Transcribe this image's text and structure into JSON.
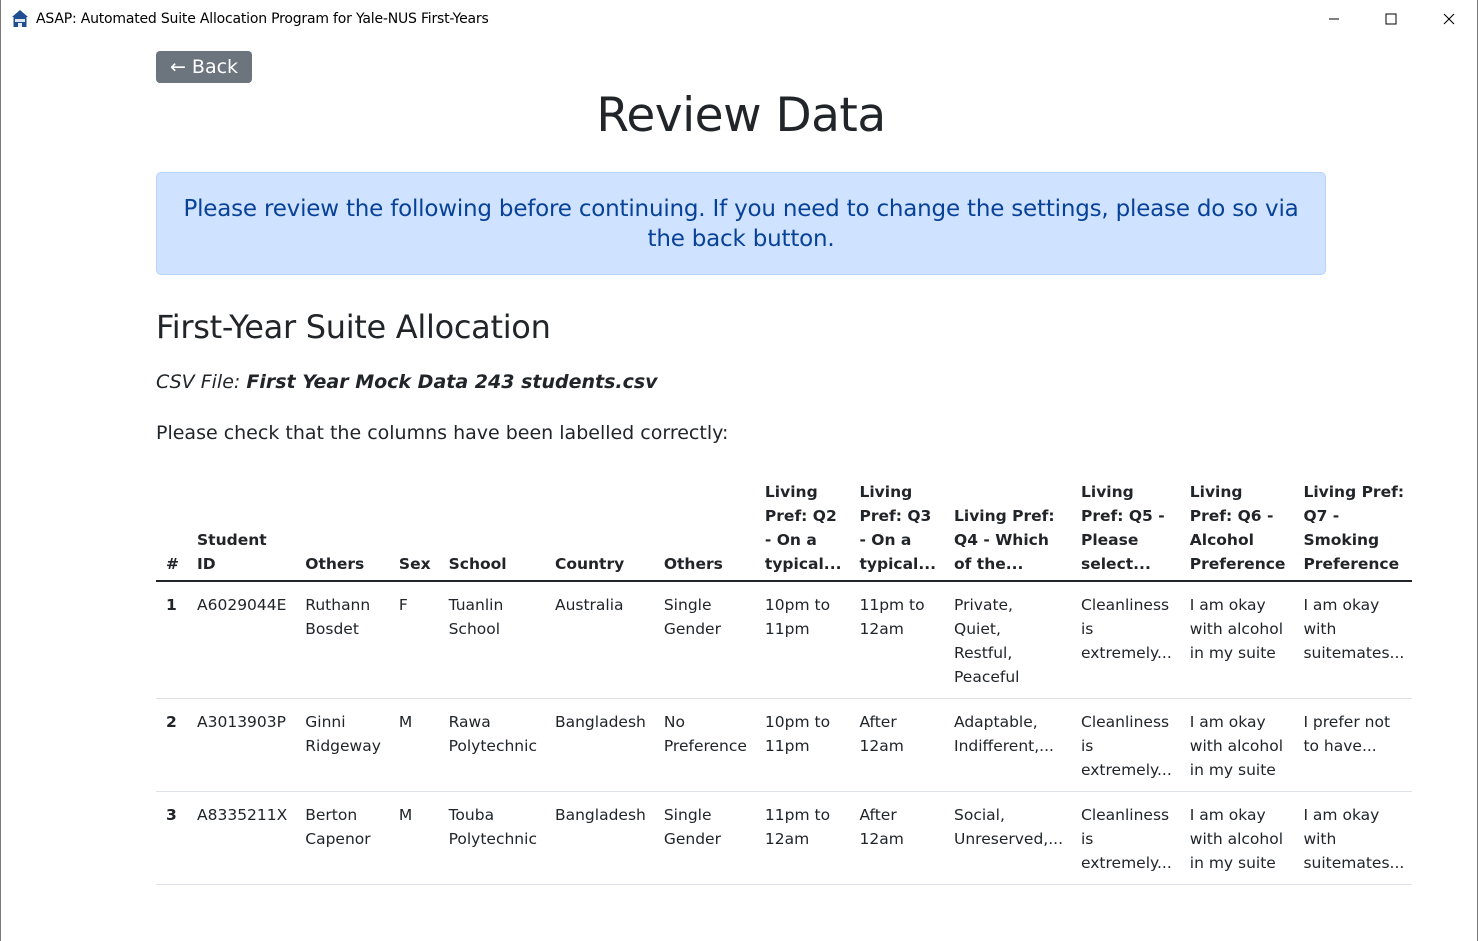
{
  "window": {
    "title": "ASAP: Automated Suite Allocation Program for Yale-NUS First-Years",
    "app_icon": "house-icon",
    "controls": {
      "minimize_icon": "minimize-icon",
      "maximize_icon": "maximize-icon",
      "close_icon": "close-icon"
    }
  },
  "page": {
    "back_label": "← Back",
    "title": "Review Data",
    "alert_text": "Please review the following before continuing. If you need to change the settings, please do so via the back button.",
    "section_title": "First-Year Suite Allocation",
    "csv_label": "CSV File: ",
    "csv_filename": "First Year Mock Data 243 students.csv",
    "check_text": "Please check that the columns have been labelled correctly:"
  },
  "colors": {
    "back_button_bg": "#6c757d",
    "alert_bg": "#cfe2ff",
    "alert_border": "#b6d4fe",
    "alert_text": "#084298"
  },
  "table": {
    "headers": [
      "#",
      "Student ID",
      "Others",
      "Sex",
      "School",
      "Country",
      "Others",
      "Living Pref: Q2 - On a typical...",
      "Living Pref: Q3 - On a typical...",
      "Living Pref: Q4 - Which of the...",
      "Living Pref: Q5 - Please select...",
      "Living Pref: Q6 - Alcohol Preference",
      "Living Pref: Q7 - Smoking Preference"
    ],
    "rows": [
      [
        "1",
        "A6029044E",
        "Ruthann Bosdet",
        "F",
        "Tuanlin School",
        "Australia",
        "Single Gender",
        "10pm to 11pm",
        "11pm to 12am",
        "Private, Quiet, Restful, Peaceful",
        "Cleanliness is extremely...",
        "I am okay with alcohol in my suite",
        "I am okay with suitemates..."
      ],
      [
        "2",
        "A3013903P",
        "Ginni Ridgeway",
        "M",
        "Rawa Polytechnic",
        "Bangladesh",
        "No Preference",
        "10pm to 11pm",
        "After 12am",
        "Adaptable, Indifferent,...",
        "Cleanliness is extremely...",
        "I am okay with alcohol in my suite",
        "I prefer not to have..."
      ],
      [
        "3",
        "A8335211X",
        "Berton Capenor",
        "M",
        "Touba Polytechnic",
        "Bangladesh",
        "Single Gender",
        "11pm to 12am",
        "After 12am",
        "Social, Unreserved,...",
        "Cleanliness is extremely...",
        "I am okay with alcohol in my suite",
        "I am okay with suitemates..."
      ]
    ]
  }
}
